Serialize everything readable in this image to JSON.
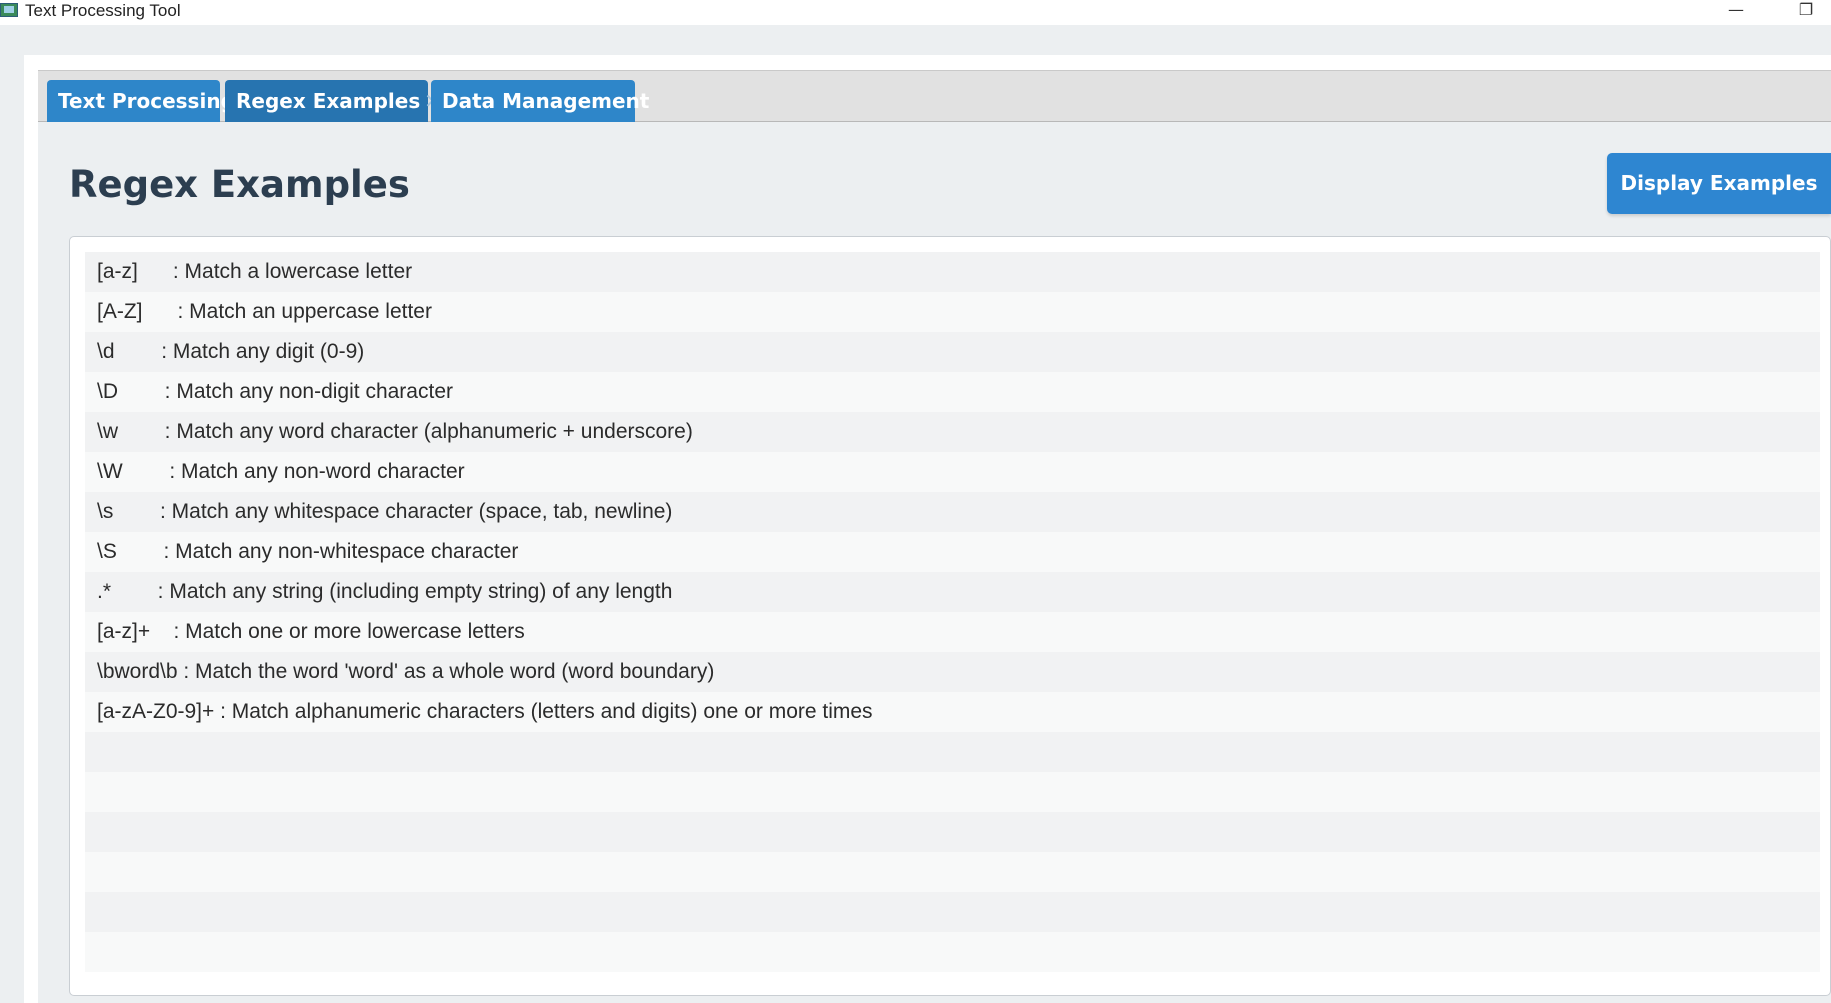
{
  "window": {
    "title": "Text Processing Tool",
    "minimize_glyph": "—",
    "restore_glyph": "❐"
  },
  "tabs": [
    {
      "label": "Text Processing",
      "active": false
    },
    {
      "label": "Regex Examples",
      "active": true,
      "close_glyph": "✕"
    },
    {
      "label": "Data Management",
      "active": false
    }
  ],
  "page": {
    "title": "Regex Examples",
    "display_button_label": "Display Examples"
  },
  "examples": [
    "[a-z]      : Match a lowercase letter",
    "[A-Z]      : Match an uppercase letter",
    "\\d        : Match any digit (0-9)",
    "\\D        : Match any non-digit character",
    "\\w        : Match any word character (alphanumeric + underscore)",
    "\\W        : Match any non-word character",
    "\\s        : Match any whitespace character (space, tab, newline)",
    "\\S        : Match any non-whitespace character",
    ".*        : Match any string (including empty string) of any length",
    "[a-z]+    : Match one or more lowercase letters",
    "\\bword\\b : Match the word 'word' as a whole word (word boundary)",
    "[a-zA-Z0-9]+ : Match alphanumeric characters (letters and digits) one or more times",
    "",
    "",
    "",
    "",
    "",
    ""
  ],
  "colors": {
    "tab_blue": "#2e86c9",
    "button_blue": "#2e86d1",
    "title_text": "#2c3e50"
  }
}
